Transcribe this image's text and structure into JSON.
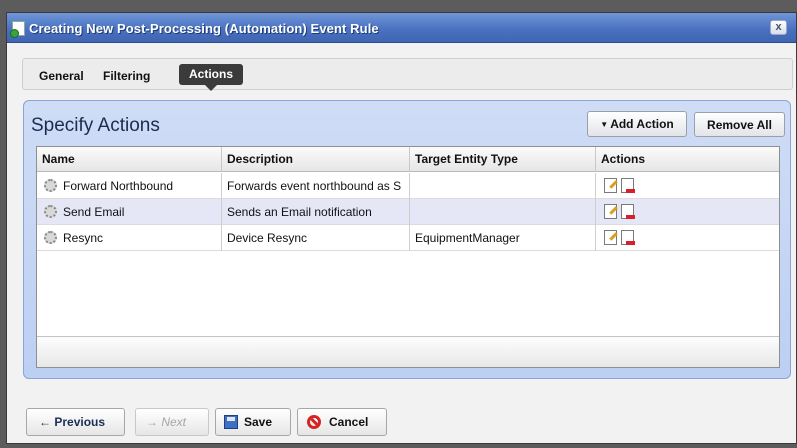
{
  "dialog": {
    "title": "Creating New Post-Processing (Automation) Event Rule",
    "close_symbol": "x"
  },
  "tabs": [
    {
      "label": "General"
    },
    {
      "label": "Filtering"
    },
    {
      "label": "Actions",
      "selected": true
    }
  ],
  "panel": {
    "title": "Specify Actions",
    "add_action_label": "Add Action",
    "remove_all_label": "Remove All"
  },
  "grid": {
    "columns": [
      "Name",
      "Description",
      "Target Entity Type",
      "Actions"
    ],
    "rows": [
      {
        "name": "Forward Northbound",
        "description": "Forwards event northbound as S",
        "target": ""
      },
      {
        "name": "Send Email",
        "description": "Sends an Email notification",
        "target": ""
      },
      {
        "name": "Resync",
        "description": "Device Resync",
        "target": "EquipmentManager"
      }
    ]
  },
  "footer": {
    "previous_label": "Previous",
    "next_label": "Next",
    "save_label": "Save",
    "cancel_label": "Cancel"
  },
  "colors": {
    "titlebar": "#4a72c0",
    "panel_bg": "#c7d7f5",
    "selected_tab": "#3b3b3b",
    "alt_row": "#e6e7f6"
  }
}
